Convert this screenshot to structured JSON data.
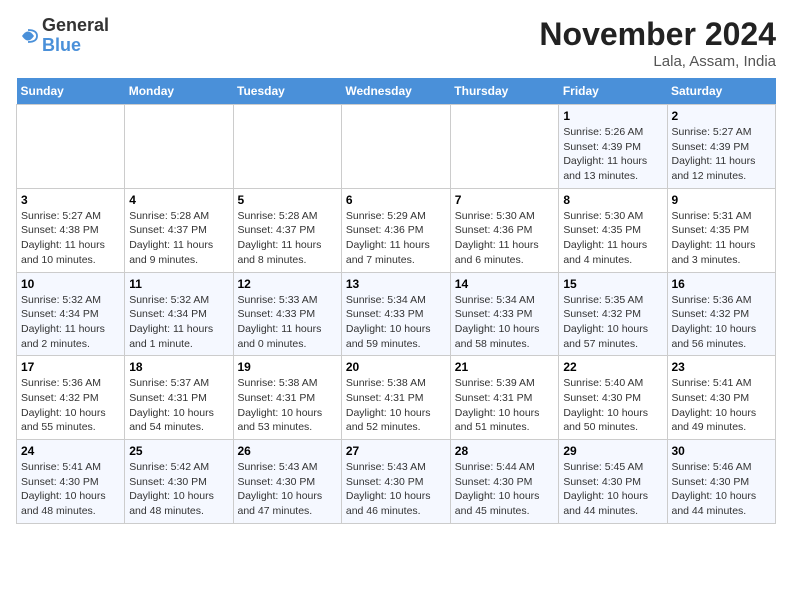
{
  "header": {
    "logo_line1": "General",
    "logo_line2": "Blue",
    "month": "November 2024",
    "location": "Lala, Assam, India"
  },
  "weekdays": [
    "Sunday",
    "Monday",
    "Tuesday",
    "Wednesday",
    "Thursday",
    "Friday",
    "Saturday"
  ],
  "weeks": [
    [
      {
        "day": "",
        "info": ""
      },
      {
        "day": "",
        "info": ""
      },
      {
        "day": "",
        "info": ""
      },
      {
        "day": "",
        "info": ""
      },
      {
        "day": "",
        "info": ""
      },
      {
        "day": "1",
        "info": "Sunrise: 5:26 AM\nSunset: 4:39 PM\nDaylight: 11 hours and 13 minutes."
      },
      {
        "day": "2",
        "info": "Sunrise: 5:27 AM\nSunset: 4:39 PM\nDaylight: 11 hours and 12 minutes."
      }
    ],
    [
      {
        "day": "3",
        "info": "Sunrise: 5:27 AM\nSunset: 4:38 PM\nDaylight: 11 hours and 10 minutes."
      },
      {
        "day": "4",
        "info": "Sunrise: 5:28 AM\nSunset: 4:37 PM\nDaylight: 11 hours and 9 minutes."
      },
      {
        "day": "5",
        "info": "Sunrise: 5:28 AM\nSunset: 4:37 PM\nDaylight: 11 hours and 8 minutes."
      },
      {
        "day": "6",
        "info": "Sunrise: 5:29 AM\nSunset: 4:36 PM\nDaylight: 11 hours and 7 minutes."
      },
      {
        "day": "7",
        "info": "Sunrise: 5:30 AM\nSunset: 4:36 PM\nDaylight: 11 hours and 6 minutes."
      },
      {
        "day": "8",
        "info": "Sunrise: 5:30 AM\nSunset: 4:35 PM\nDaylight: 11 hours and 4 minutes."
      },
      {
        "day": "9",
        "info": "Sunrise: 5:31 AM\nSunset: 4:35 PM\nDaylight: 11 hours and 3 minutes."
      }
    ],
    [
      {
        "day": "10",
        "info": "Sunrise: 5:32 AM\nSunset: 4:34 PM\nDaylight: 11 hours and 2 minutes."
      },
      {
        "day": "11",
        "info": "Sunrise: 5:32 AM\nSunset: 4:34 PM\nDaylight: 11 hours and 1 minute."
      },
      {
        "day": "12",
        "info": "Sunrise: 5:33 AM\nSunset: 4:33 PM\nDaylight: 11 hours and 0 minutes."
      },
      {
        "day": "13",
        "info": "Sunrise: 5:34 AM\nSunset: 4:33 PM\nDaylight: 10 hours and 59 minutes."
      },
      {
        "day": "14",
        "info": "Sunrise: 5:34 AM\nSunset: 4:33 PM\nDaylight: 10 hours and 58 minutes."
      },
      {
        "day": "15",
        "info": "Sunrise: 5:35 AM\nSunset: 4:32 PM\nDaylight: 10 hours and 57 minutes."
      },
      {
        "day": "16",
        "info": "Sunrise: 5:36 AM\nSunset: 4:32 PM\nDaylight: 10 hours and 56 minutes."
      }
    ],
    [
      {
        "day": "17",
        "info": "Sunrise: 5:36 AM\nSunset: 4:32 PM\nDaylight: 10 hours and 55 minutes."
      },
      {
        "day": "18",
        "info": "Sunrise: 5:37 AM\nSunset: 4:31 PM\nDaylight: 10 hours and 54 minutes."
      },
      {
        "day": "19",
        "info": "Sunrise: 5:38 AM\nSunset: 4:31 PM\nDaylight: 10 hours and 53 minutes."
      },
      {
        "day": "20",
        "info": "Sunrise: 5:38 AM\nSunset: 4:31 PM\nDaylight: 10 hours and 52 minutes."
      },
      {
        "day": "21",
        "info": "Sunrise: 5:39 AM\nSunset: 4:31 PM\nDaylight: 10 hours and 51 minutes."
      },
      {
        "day": "22",
        "info": "Sunrise: 5:40 AM\nSunset: 4:30 PM\nDaylight: 10 hours and 50 minutes."
      },
      {
        "day": "23",
        "info": "Sunrise: 5:41 AM\nSunset: 4:30 PM\nDaylight: 10 hours and 49 minutes."
      }
    ],
    [
      {
        "day": "24",
        "info": "Sunrise: 5:41 AM\nSunset: 4:30 PM\nDaylight: 10 hours and 48 minutes."
      },
      {
        "day": "25",
        "info": "Sunrise: 5:42 AM\nSunset: 4:30 PM\nDaylight: 10 hours and 48 minutes."
      },
      {
        "day": "26",
        "info": "Sunrise: 5:43 AM\nSunset: 4:30 PM\nDaylight: 10 hours and 47 minutes."
      },
      {
        "day": "27",
        "info": "Sunrise: 5:43 AM\nSunset: 4:30 PM\nDaylight: 10 hours and 46 minutes."
      },
      {
        "day": "28",
        "info": "Sunrise: 5:44 AM\nSunset: 4:30 PM\nDaylight: 10 hours and 45 minutes."
      },
      {
        "day": "29",
        "info": "Sunrise: 5:45 AM\nSunset: 4:30 PM\nDaylight: 10 hours and 44 minutes."
      },
      {
        "day": "30",
        "info": "Sunrise: 5:46 AM\nSunset: 4:30 PM\nDaylight: 10 hours and 44 minutes."
      }
    ]
  ]
}
